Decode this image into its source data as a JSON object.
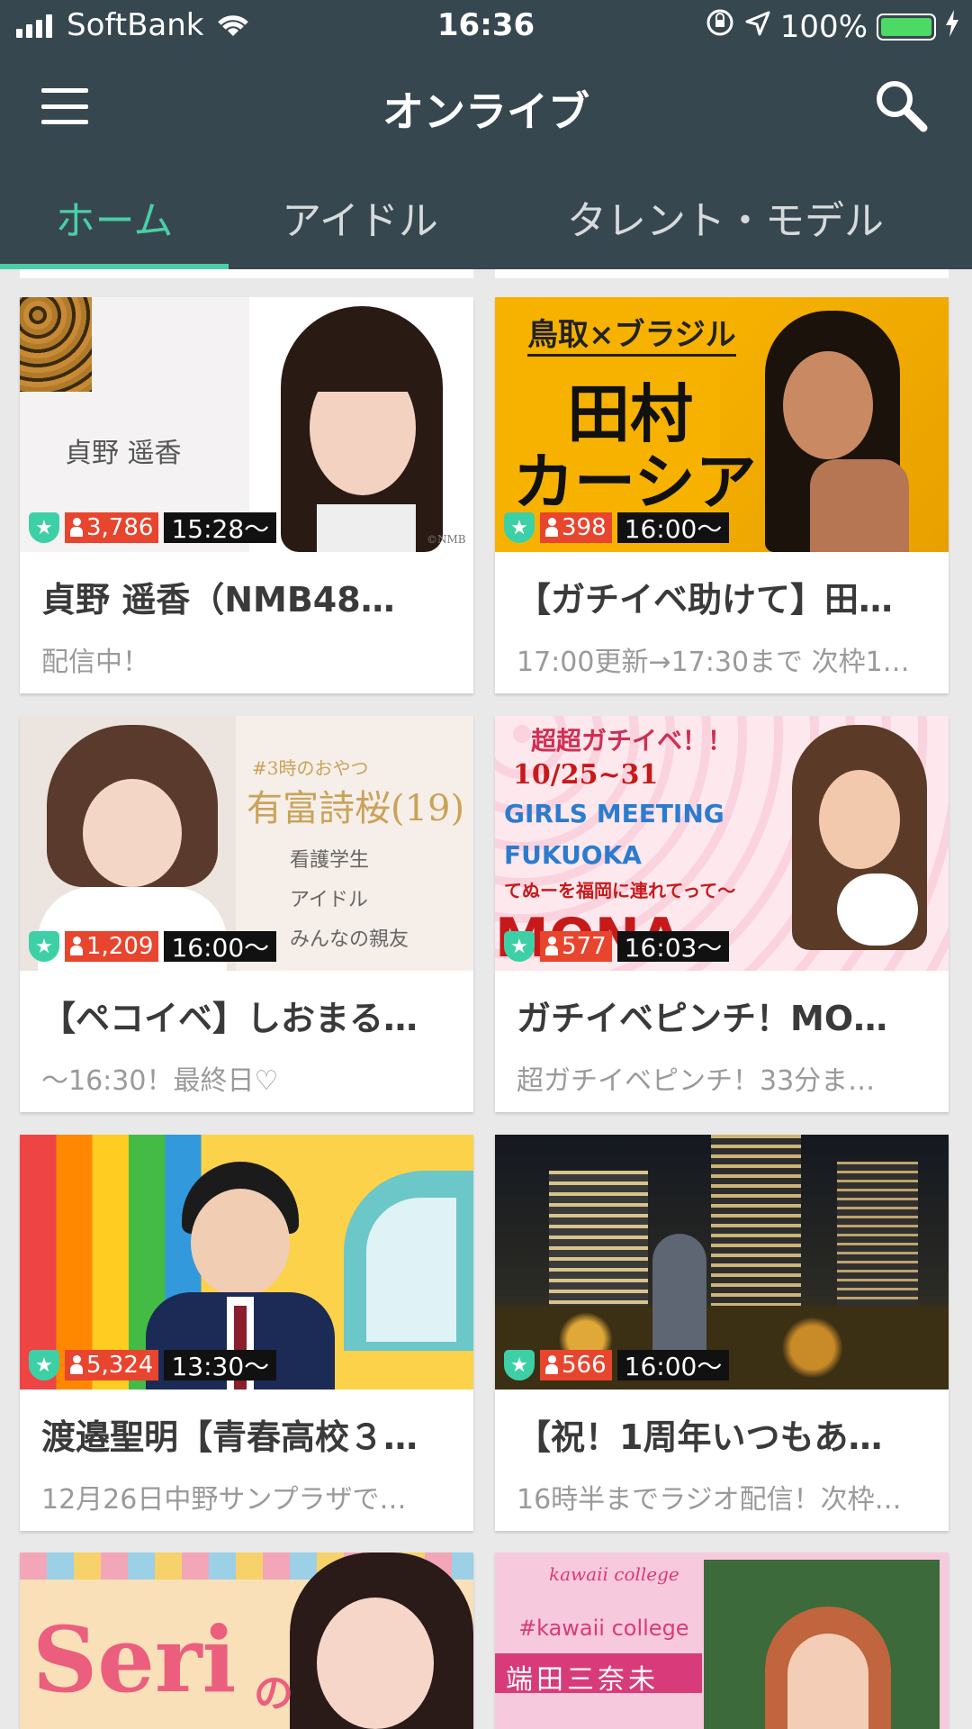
{
  "status_bar": {
    "carrier": "SoftBank",
    "time": "16:36",
    "battery": "100%",
    "battery_level": 1.0
  },
  "app_bar": {
    "title": "オンライブ",
    "menu_icon": "hamburger-menu-icon",
    "search_icon": "search-icon"
  },
  "tabs": [
    {
      "label": "ホーム",
      "active": true
    },
    {
      "label": "アイドル",
      "active": false
    },
    {
      "label": "タレント・モデル",
      "active": false
    }
  ],
  "cards": [
    {
      "title": "貞野 遥香（NMB48…",
      "subtitle": "配信中！",
      "viewers": "3,786",
      "time": "15:28〜",
      "thumb_text": [
        "貞野 遥香",
        "©NMB"
      ]
    },
    {
      "title": "【ガチイベ助けて】田…",
      "subtitle": "17:00更新→17:30まで 次枠1…",
      "viewers": "398",
      "time": "16:00〜",
      "thumb_text": [
        "鳥取×ブラジル",
        "田村",
        "カーシア"
      ]
    },
    {
      "title": "【ペコイベ】しおまる…",
      "subtitle": "〜16:30！最終日♡",
      "viewers": "1,209",
      "time": "16:00〜",
      "thumb_text": [
        "#3時のおやつ",
        "有富詩桜(19)",
        "看護学生",
        "アイドル",
        "みんなの親友"
      ]
    },
    {
      "title": "ガチイベピンチ！MO…",
      "subtitle": "超ガチイベピンチ！33分ま…",
      "viewers": "577",
      "time": "16:03〜",
      "thumb_text": [
        "超超ガチイベ！！",
        "10/25~31",
        "GIRLS MEETING",
        "FUKUOKA",
        "てぬーを福岡に連れてって〜",
        "MONA"
      ]
    },
    {
      "title": "渡邉聖明【青春高校３…",
      "subtitle": "12月26日中野サンプラザで…",
      "viewers": "5,324",
      "time": "13:30〜",
      "thumb_text": []
    },
    {
      "title": "【祝！1周年いつもあ…",
      "subtitle": "16時半までラジオ配信！次枠…",
      "viewers": "566",
      "time": "16:00〜",
      "thumb_text": []
    },
    {
      "title": "",
      "subtitle": "",
      "viewers": "",
      "time": "",
      "thumb_text": [
        "Seri",
        "の"
      ]
    },
    {
      "title": "",
      "subtitle": "",
      "viewers": "",
      "time": "",
      "thumb_text": [
        "kawaii college",
        "#kawaii college",
        "端田三奈未"
      ]
    }
  ]
}
